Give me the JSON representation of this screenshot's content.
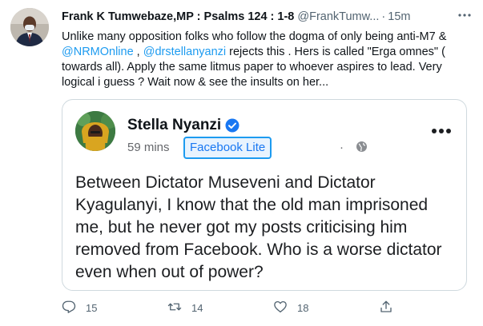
{
  "tweet": {
    "author_name": "Frank K Tumwebaze,MP : Psalms 124 : 1-8",
    "author_handle": "@FrankTumw...",
    "separator": "·",
    "time": "15m",
    "body_part1": "Unlike many opposition folks who follow the dogma of only being anti-M7 & ",
    "mention1": "@NRMOnline",
    "body_part2": " , ",
    "mention2": "@drstellanyanzi",
    "body_part3": " rejects this . Hers is called \"Erga omnes\" ( towards all). Apply the same  litmus paper to whoever aspires to lead. Very logical i guess ? Wait now & see the insults on her..."
  },
  "embed": {
    "name": "Stella Nyanzi",
    "time": "59 mins",
    "badge": "Facebook Lite",
    "separator": "·",
    "post_text": "Between Dictator Museveni and Dictator Kyagulanyi, I know that the old man imprisoned me, but he never got my posts criticising him removed from Facebook. Who is a worse dictator even when out of power?"
  },
  "actions": {
    "reply_count": "15",
    "retweet_count": "14",
    "like_count": "18"
  },
  "colors": {
    "accent": "#1d9bf0",
    "secondary_text": "#536471",
    "border": "#cfd9de"
  },
  "icons": [
    "more-icon",
    "verified-icon",
    "globe-icon",
    "reply-icon",
    "retweet-icon",
    "like-icon",
    "share-icon"
  ]
}
